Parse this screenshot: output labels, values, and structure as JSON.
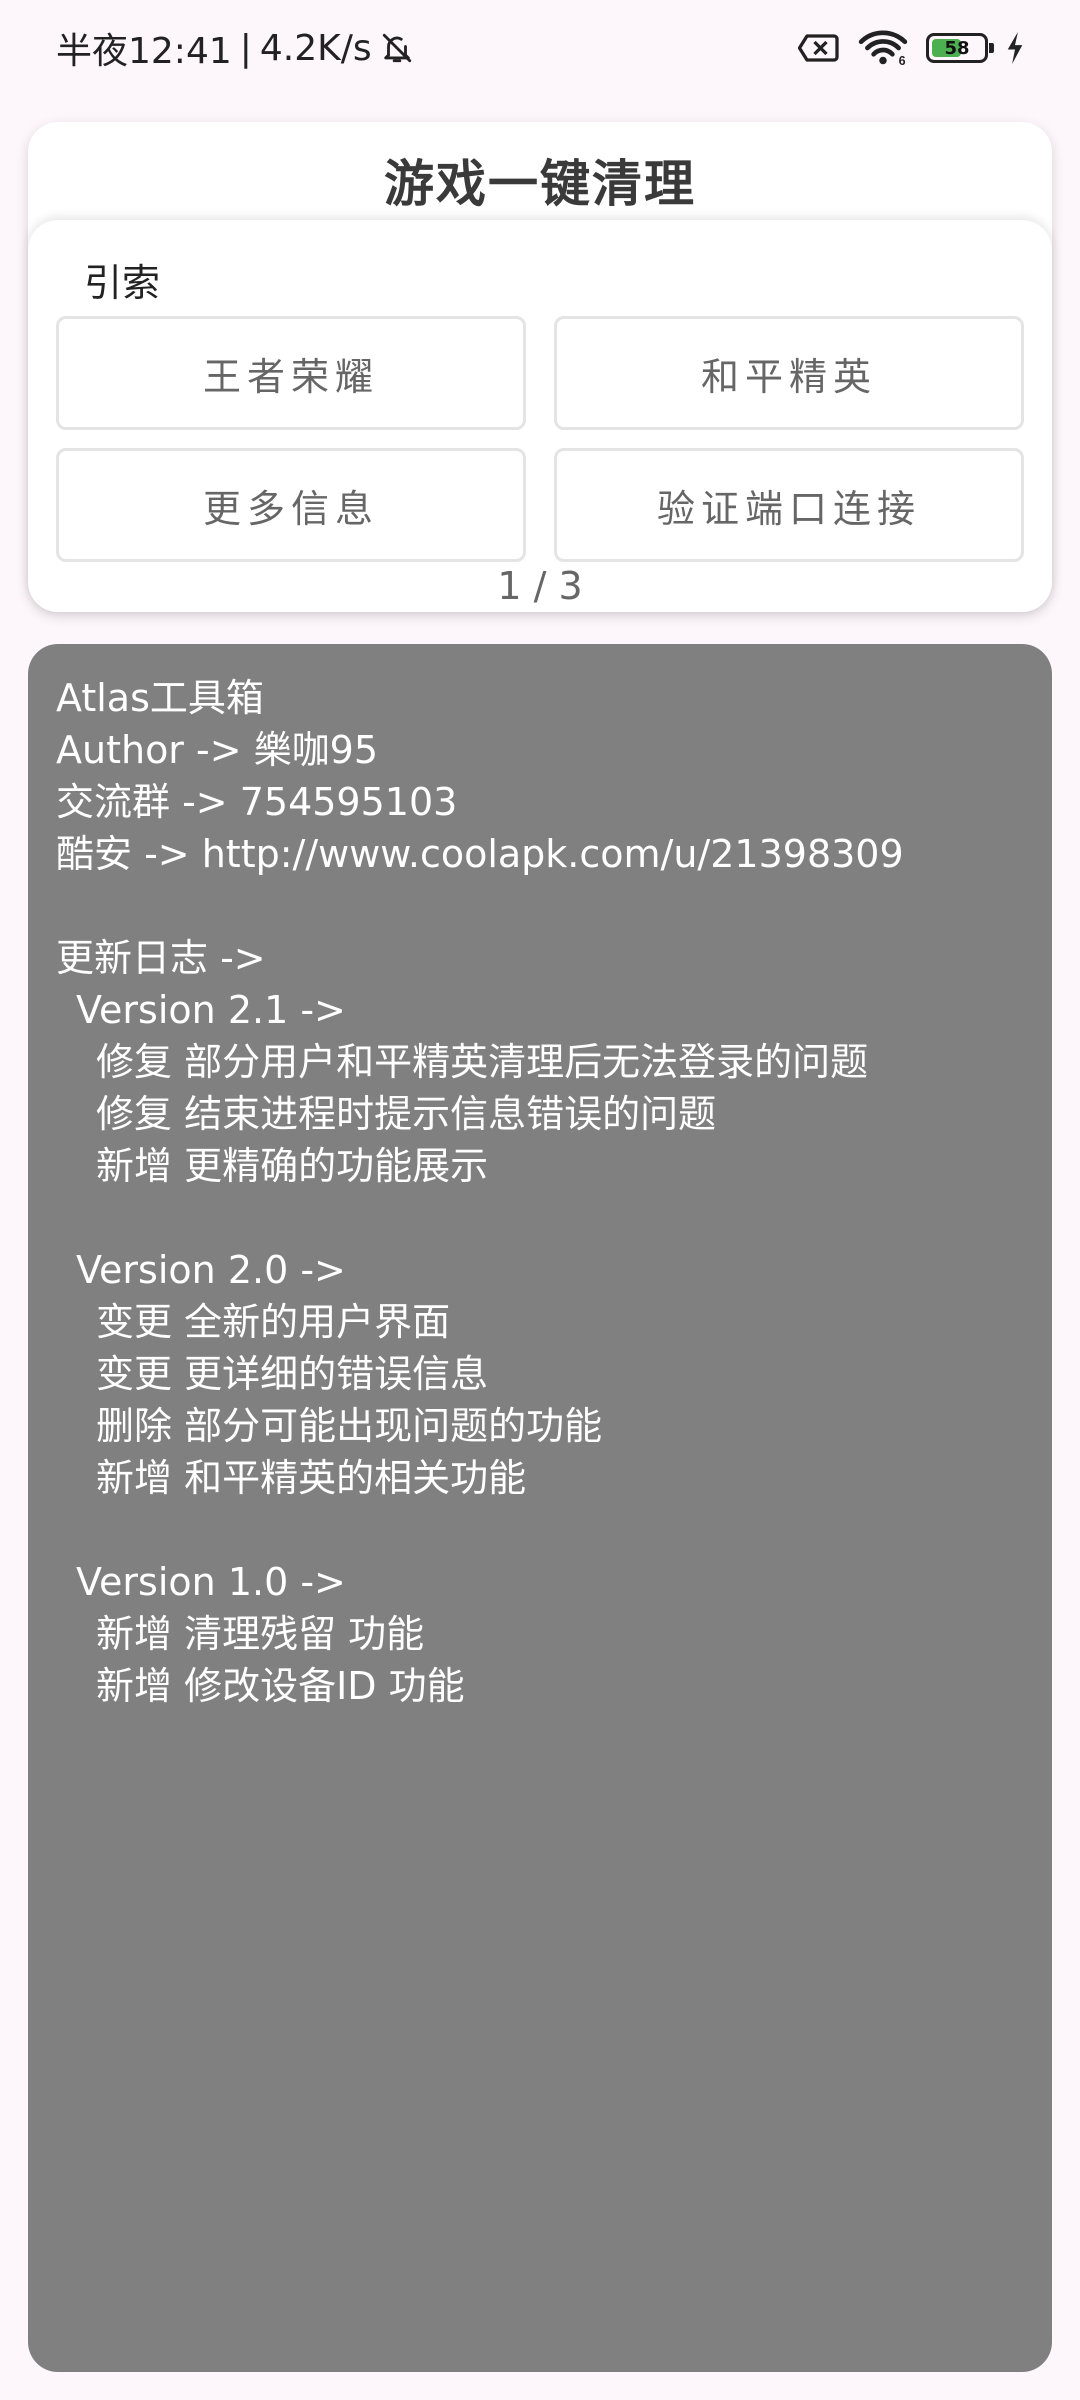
{
  "status_bar": {
    "time": "半夜12:41",
    "separator": "|",
    "network_speed": "4.2K/s",
    "icons": [
      "bell-off-icon",
      "sim-disabled-icon",
      "wifi-icon",
      "battery-icon",
      "charging-icon"
    ],
    "wifi_label": "6",
    "battery_level": "58",
    "battery_fill": 0.58
  },
  "header": {
    "title": "游戏一键清理"
  },
  "guide": {
    "label": "引索",
    "buttons": [
      "王者荣耀",
      "和平精英",
      "更多信息",
      "验证端口连接"
    ],
    "pager": "1 / 3"
  },
  "info": {
    "app_name": "Atlas工具箱",
    "author": "Author -> 樂咖95",
    "group": "交流群 -> 754595103",
    "coolapk": "酷安 -> http://www.coolapk.com/u/21398309",
    "changelog_title": "更新日志 ->",
    "versions": [
      {
        "title": "Version 2.1 ->",
        "items": [
          "修复 部分用户和平精英清理后无法登录的问题",
          "修复 结束进程时提示信息错误的问题",
          "新增 更精确的功能展示"
        ]
      },
      {
        "title": "Version 2.0 ->",
        "items": [
          "变更 全新的用户界面",
          "变更 更详细的错误信息",
          "删除 部分可能出现问题的功能",
          "新增 和平精英的相关功能"
        ]
      },
      {
        "title": "Version 1.0 ->",
        "items": [
          "新增 清理残留 功能",
          "新增 修改设备ID 功能"
        ]
      }
    ]
  },
  "colors": {
    "background": "#fdf6fb",
    "panel": "#808080",
    "battery_green": "#4caf50"
  }
}
